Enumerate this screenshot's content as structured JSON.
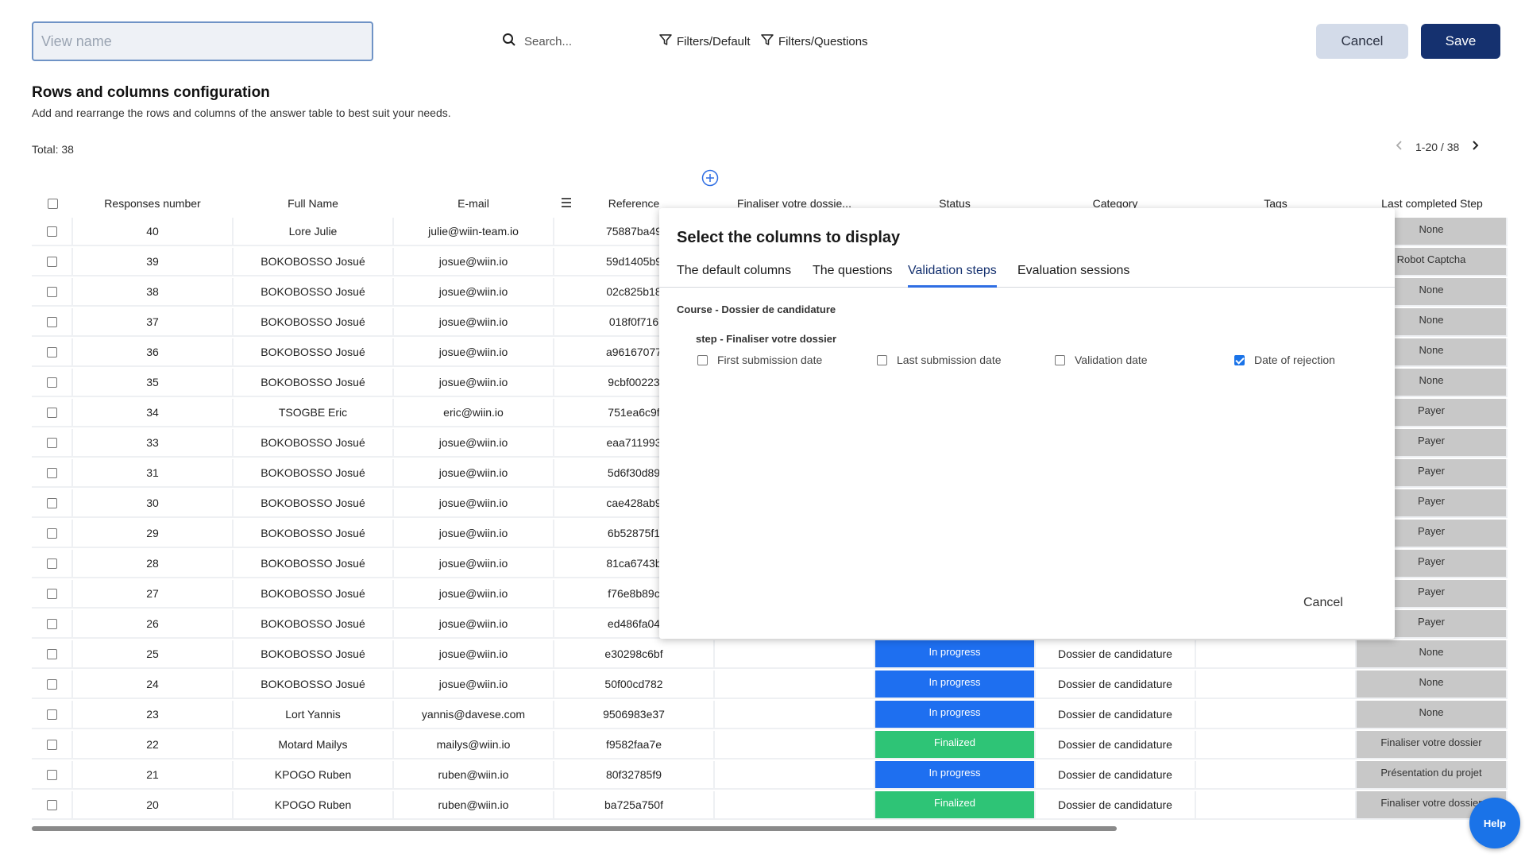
{
  "toolbar": {
    "view_name_placeholder": "View name",
    "search_label": "Search...",
    "filter_default": "Filters/Default",
    "filter_questions": "Filters/Questions",
    "cancel_label": "Cancel",
    "save_label": "Save"
  },
  "section": {
    "title": "Rows and columns configuration",
    "subtitle": "Add and rearrange the rows and columns of the answer table to best suit your needs."
  },
  "summary": {
    "total": "Total: 38",
    "pagination": "1-20 / 38"
  },
  "table": {
    "headers": [
      "Responses number",
      "Full Name",
      "E-mail",
      "Reference",
      "Finaliser votre dossie...",
      "Status",
      "Category",
      "Tags",
      "Last completed Step"
    ],
    "rows": [
      {
        "num": "40",
        "name": "Lore Julie",
        "email": "julie@wiin-team.io",
        "ref": "75887ba49",
        "status": "",
        "category": "",
        "last": "None"
      },
      {
        "num": "39",
        "name": "BOKOBOSSO Josué",
        "email": "josue@wiin.io",
        "ref": "59d1405b9",
        "status": "",
        "category": "",
        "last": "Robot Captcha"
      },
      {
        "num": "38",
        "name": "BOKOBOSSO Josué",
        "email": "josue@wiin.io",
        "ref": "02c825b18",
        "status": "",
        "category": "",
        "last": "None"
      },
      {
        "num": "37",
        "name": "BOKOBOSSO Josué",
        "email": "josue@wiin.io",
        "ref": "018f0f716",
        "status": "",
        "category": "",
        "last": "None"
      },
      {
        "num": "36",
        "name": "BOKOBOSSO Josué",
        "email": "josue@wiin.io",
        "ref": "a96167077",
        "status": "",
        "category": "",
        "last": "None"
      },
      {
        "num": "35",
        "name": "BOKOBOSSO Josué",
        "email": "josue@wiin.io",
        "ref": "9cbf00223",
        "status": "",
        "category": "",
        "last": "None"
      },
      {
        "num": "34",
        "name": "TSOGBE Eric",
        "email": "eric@wiin.io",
        "ref": "751ea6c9f",
        "status": "",
        "category": "",
        "last": "Payer"
      },
      {
        "num": "33",
        "name": "BOKOBOSSO Josué",
        "email": "josue@wiin.io",
        "ref": "eaa711993",
        "status": "",
        "category": "",
        "last": "Payer"
      },
      {
        "num": "31",
        "name": "BOKOBOSSO Josué",
        "email": "josue@wiin.io",
        "ref": "5d6f30d89",
        "status": "",
        "category": "",
        "last": "Payer"
      },
      {
        "num": "30",
        "name": "BOKOBOSSO Josué",
        "email": "josue@wiin.io",
        "ref": "cae428ab9",
        "status": "",
        "category": "",
        "last": "Payer"
      },
      {
        "num": "29",
        "name": "BOKOBOSSO Josué",
        "email": "josue@wiin.io",
        "ref": "6b52875f1",
        "status": "",
        "category": "",
        "last": "Payer"
      },
      {
        "num": "28",
        "name": "BOKOBOSSO Josué",
        "email": "josue@wiin.io",
        "ref": "81ca6743b",
        "status": "",
        "category": "",
        "last": "Payer"
      },
      {
        "num": "27",
        "name": "BOKOBOSSO Josué",
        "email": "josue@wiin.io",
        "ref": "f76e8b89c",
        "status": "",
        "category": "",
        "last": "Payer"
      },
      {
        "num": "26",
        "name": "BOKOBOSSO Josué",
        "email": "josue@wiin.io",
        "ref": "ed486fa04",
        "status": "",
        "category": "",
        "last": "Payer"
      },
      {
        "num": "25",
        "name": "BOKOBOSSO Josué",
        "email": "josue@wiin.io",
        "ref": "e30298c6bf",
        "status": "In progress",
        "category": "Dossier de candidature",
        "last": "None"
      },
      {
        "num": "24",
        "name": "BOKOBOSSO Josué",
        "email": "josue@wiin.io",
        "ref": "50f00cd782",
        "status": "In progress",
        "category": "Dossier de candidature",
        "last": "None"
      },
      {
        "num": "23",
        "name": "Lort Yannis",
        "email": "yannis@davese.com",
        "ref": "9506983e37",
        "status": "In progress",
        "category": "Dossier de candidature",
        "last": "None"
      },
      {
        "num": "22",
        "name": "Motard Mailys",
        "email": "mailys@wiin.io",
        "ref": "f9582faa7e",
        "status": "Finalized",
        "category": "Dossier de candidature",
        "last": "Finaliser votre dossier"
      },
      {
        "num": "21",
        "name": "KPOGO Ruben",
        "email": "ruben@wiin.io",
        "ref": "80f32785f9",
        "status": "In progress",
        "category": "Dossier de candidature",
        "last": "Présentation du projet"
      },
      {
        "num": "20",
        "name": "KPOGO Ruben",
        "email": "ruben@wiin.io",
        "ref": "ba725a750f",
        "status": "Finalized",
        "category": "Dossier de candidature",
        "last": "Finaliser votre dossier"
      }
    ]
  },
  "modal": {
    "title": "Select the columns to display",
    "tabs": [
      "The default columns",
      "The questions",
      "Validation steps",
      "Evaluation sessions"
    ],
    "active_tab": "Validation steps",
    "course_label": "Course - Dossier de candidature",
    "step_label": "step - Finaliser votre dossier",
    "options": [
      {
        "label": "First submission date",
        "checked": false
      },
      {
        "label": "Last submission date",
        "checked": false
      },
      {
        "label": "Validation date",
        "checked": false
      },
      {
        "label": "Date of rejection",
        "checked": true
      }
    ],
    "cancel_label": "Cancel"
  },
  "help_label": "Help",
  "colors": {
    "primary": "#15316f",
    "accent": "#1a73e8",
    "in_progress": "#1e6ff0",
    "finalized": "#2ec476",
    "last_step_bg": "#c8c8c8"
  },
  "icons": [
    "search-icon",
    "filter-icon",
    "menu-icon",
    "more-icon",
    "add-circle-icon",
    "chevron-left-icon",
    "chevron-right-icon"
  ]
}
